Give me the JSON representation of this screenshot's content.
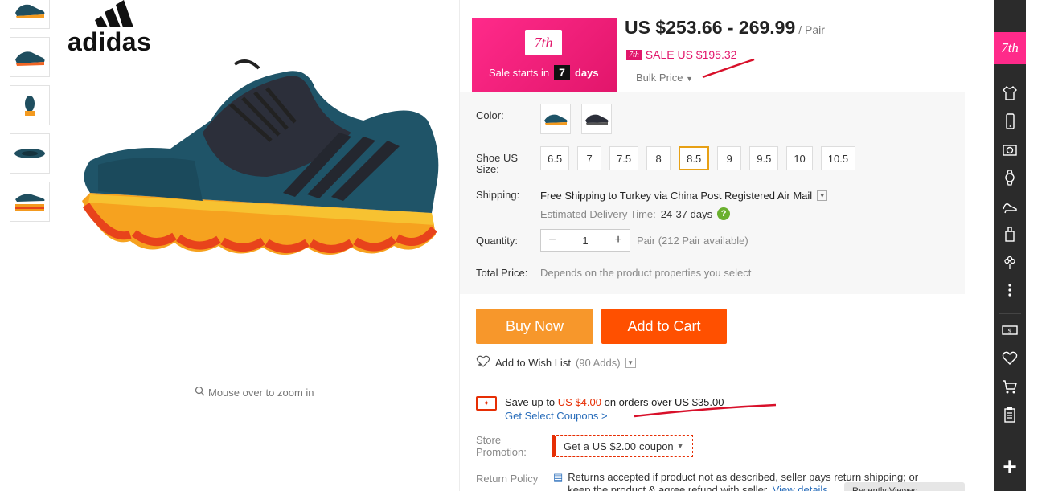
{
  "brand": {
    "logo_text": "adidas"
  },
  "gallery": {
    "thumb_count": 5,
    "zoom_hint": "Mouse over to zoom in"
  },
  "promo": {
    "badge": "7th",
    "starts_text": "Sale starts in",
    "days_number": "7",
    "days_label": "days"
  },
  "price": {
    "range": "US $253.66 - 269.99",
    "unit": "/ Pair",
    "sale_badge": "7th",
    "sale_text": "SALE US $195.32",
    "bulk_label": "Bulk Price"
  },
  "options": {
    "color_label": "Color:",
    "size_label": "Shoe US Size:",
    "sizes": [
      "6.5",
      "7",
      "7.5",
      "8",
      "8.5",
      "9",
      "9.5",
      "10",
      "10.5"
    ],
    "selected_size": "8.5",
    "shipping_label": "Shipping:",
    "shipping_text": "Free Shipping to Turkey via China Post Registered Air Mail",
    "estimated_label": "Estimated Delivery Time:",
    "estimated_days": "24-37 days",
    "quantity_label": "Quantity:",
    "quantity_value": "1",
    "quantity_available": "Pair (212 Pair available)",
    "total_label": "Total Price:",
    "total_text": "Depends on the product properties you select"
  },
  "actions": {
    "buy_now": "Buy Now",
    "add_to_cart": "Add to Cart",
    "wish_list": "Add to Wish List",
    "wish_count": "(90 Adds)"
  },
  "coupons": {
    "save_prefix": "Save up to",
    "save_amount": "US $4.00",
    "save_suffix": "on orders over US $35.00",
    "link": "Get Select Coupons >",
    "store_label": "Store Promotion:",
    "store_coupon_prefix": "Get a",
    "store_coupon_amount": "US $2.00",
    "store_coupon_suffix": "coupon"
  },
  "returns": {
    "label": "Return Policy",
    "text": "Returns accepted if product not as described, seller pays return shipping; or keep the product & agree refund with seller.",
    "link": "View details"
  },
  "floating": {
    "text": "Recently Viewed"
  },
  "sidebar": {
    "top_badge": "7th",
    "icons": [
      "shirt-icon",
      "phone-icon",
      "camera-icon",
      "watch-icon",
      "heel-icon",
      "bottle-icon",
      "flower-icon",
      "more-icon",
      "coupon-icon",
      "heart-icon",
      "cart-icon",
      "clipboard-icon",
      "plus-icon"
    ]
  },
  "colors": {
    "accent": "#ff5000",
    "buy": "#f7972b",
    "promo": "#e2166b",
    "link": "#2a6ebb"
  }
}
